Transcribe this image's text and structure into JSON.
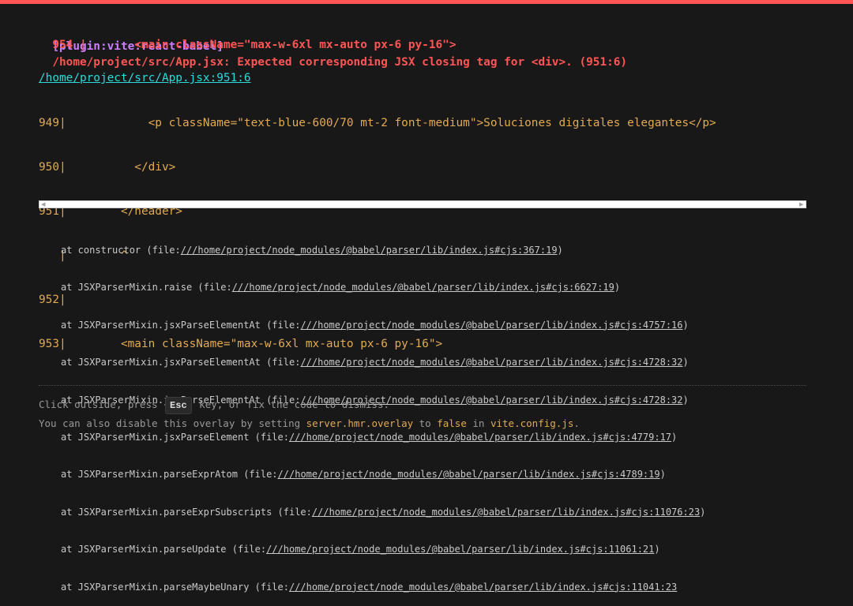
{
  "error": {
    "plugin": "[plugin:vite:react-babel]",
    "message": "/home/project/src/App.jsx: Expected corresponding JSX closing tag for <div>. (951:6)",
    "message_line2": "  954 |       <main className=\"max-w-6xl mx-auto px-6 py-16\">"
  },
  "file": {
    "link": "/home/project/src/App.jsx:951:6"
  },
  "frame": [
    "949|            <p className=\"text-blue-600/70 mt-2 font-medium\">Soluciones digitales elegantes</p>",
    "950|          </div>",
    "951|        </header>",
    "   |        ^",
    "952|",
    "953|        <main className=\"max-w-6xl mx-auto px-6 py-16\">"
  ],
  "scroll": {
    "left_arrow": "◀",
    "right_arrow": "▶"
  },
  "stack": [
    {
      "prefix": "at constructor (file:",
      "link": "///home/project/node_modules/@babel/parser/lib/index.js#cjs:367:19",
      "suffix": ")"
    },
    {
      "prefix": "at JSXParserMixin.raise (file:",
      "link": "///home/project/node_modules/@babel/parser/lib/index.js#cjs:6627:19",
      "suffix": ")"
    },
    {
      "prefix": "at JSXParserMixin.jsxParseElementAt (file:",
      "link": "///home/project/node_modules/@babel/parser/lib/index.js#cjs:4757:16",
      "suffix": ")"
    },
    {
      "prefix": "at JSXParserMixin.jsxParseElementAt (file:",
      "link": "///home/project/node_modules/@babel/parser/lib/index.js#cjs:4728:32",
      "suffix": ")"
    },
    {
      "prefix": "at JSXParserMixin.jsxParseElementAt (file:",
      "link": "///home/project/node_modules/@babel/parser/lib/index.js#cjs:4728:32",
      "suffix": ")"
    },
    {
      "prefix": "at JSXParserMixin.jsxParseElement (file:",
      "link": "///home/project/node_modules/@babel/parser/lib/index.js#cjs:4779:17",
      "suffix": ")"
    },
    {
      "prefix": "at JSXParserMixin.parseExprAtom (file:",
      "link": "///home/project/node_modules/@babel/parser/lib/index.js#cjs:4789:19",
      "suffix": ")"
    },
    {
      "prefix": "at JSXParserMixin.parseExprSubscripts (file:",
      "link": "///home/project/node_modules/@babel/parser/lib/index.js#cjs:11076:23",
      "suffix": ")"
    },
    {
      "prefix": "at JSXParserMixin.parseUpdate (file:",
      "link": "///home/project/node_modules/@babel/parser/lib/index.js#cjs:11061:21",
      "suffix": ")"
    },
    {
      "prefix": "at JSXParserMixin.parseMaybeUnary (file:",
      "link": "///home/project/node_modules/@babel/parser/lib/index.js#cjs:11041:23",
      "suffix": ""
    }
  ],
  "tip": {
    "line1_a": "Click outside, press ",
    "esc_key": "Esc",
    "line1_b": " key, or fix the code to dismiss.",
    "line2_a": "You can also disable this overlay by setting ",
    "config_key": "server.hmr.overlay",
    "line2_b": " to ",
    "false_value": "false",
    "line2_c": " in ",
    "config_file": "vite.config.js",
    "line2_d": "."
  },
  "colors": {
    "accent_red": "#ff5555",
    "plugin_purple": "#cb7eff",
    "link_cyan": "#2dd9da",
    "code_yellow": "#e2aa53",
    "background": "#181818"
  }
}
